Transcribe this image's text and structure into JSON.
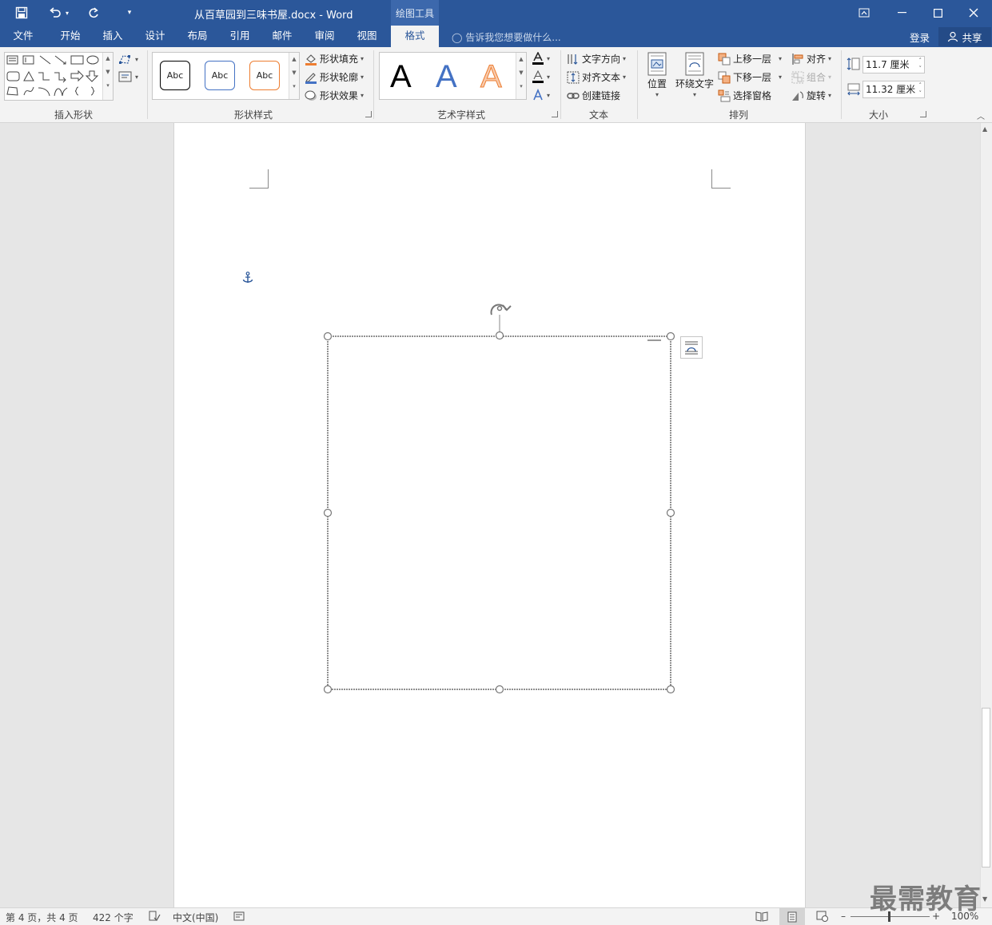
{
  "window": {
    "title": "从百草园到三味书屋.docx - Word",
    "context_label": "绘图工具"
  },
  "tabs": [
    "文件",
    "开始",
    "插入",
    "设计",
    "布局",
    "引用",
    "邮件",
    "审阅",
    "视图",
    "格式"
  ],
  "active_tab": "格式",
  "tell_me": "告诉我您想要做什么...",
  "account": {
    "login": "登录",
    "share": "共享"
  },
  "ribbon": {
    "groups": {
      "insert_shapes": "插入形状",
      "shape_styles": "形状样式",
      "wordart_styles": "艺术字样式",
      "text": "文本",
      "arrange": "排列",
      "size": "大小"
    },
    "shape_styles": {
      "preset_label": "Abc",
      "fill": "形状填充",
      "outline": "形状轮廓",
      "effects": "形状效果"
    },
    "wordart_letter": "A",
    "text": {
      "direction": "文字方向",
      "align": "对齐文本",
      "link": "创建链接"
    },
    "arrange": {
      "position": "位置",
      "wrap": "环绕文字",
      "bring_forward": "上移一层",
      "send_backward": "下移一层",
      "selection_pane": "选择窗格",
      "align": "对齐",
      "group": "组合",
      "rotate": "旋转"
    },
    "size": {
      "height": "11.7 厘米",
      "width": "11.32 厘米"
    }
  },
  "statusbar": {
    "page": "第 4 页，共 4 页",
    "words": "422 个字",
    "language": "中文(中国)",
    "zoom": "100%"
  },
  "watermark": "最需教育",
  "colors": {
    "title_bar": "#2b579a",
    "ribbon_bg": "#f3f3f3",
    "style_black": "#000000",
    "style_blue": "#4472c4",
    "style_orange": "#ed7d31"
  }
}
